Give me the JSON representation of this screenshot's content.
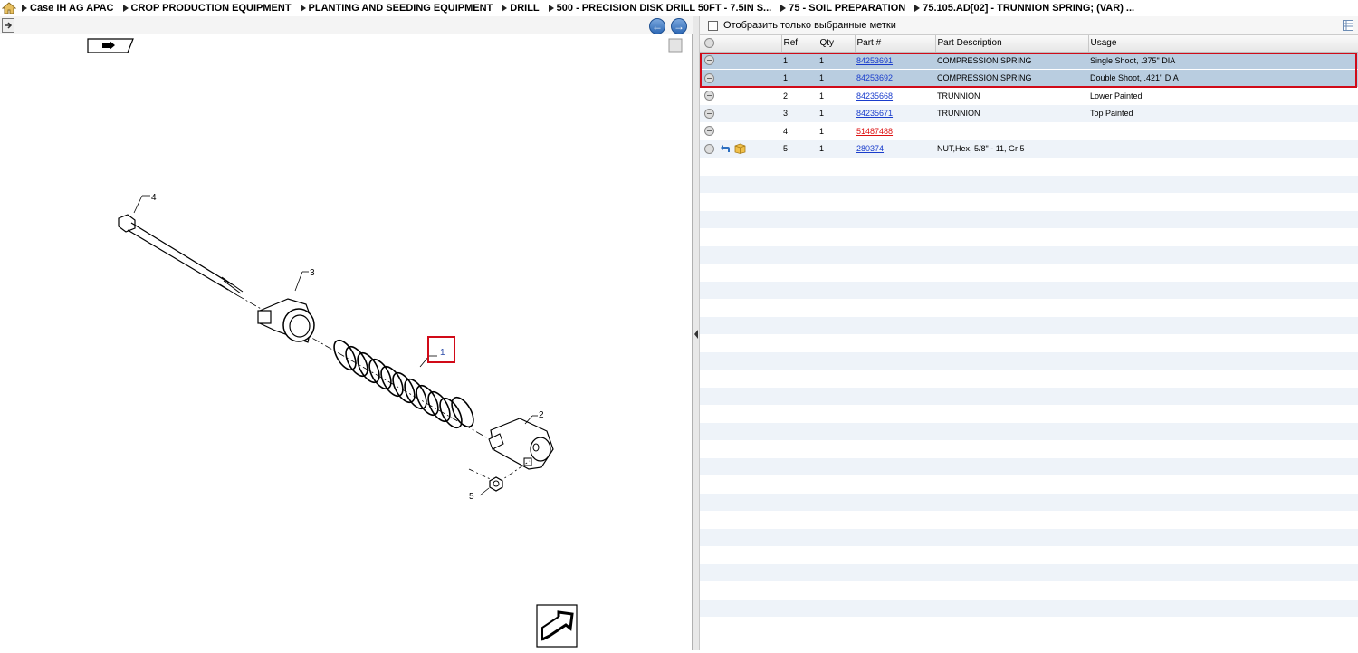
{
  "breadcrumb": [
    "Case IH AG APAC",
    "CROP PRODUCTION EQUIPMENT",
    "PLANTING AND SEEDING EQUIPMENT",
    "DRILL",
    "500 - PRECISION DISK DRILL 50FT - 7.5IN S...",
    "75 - SOIL PREPARATION",
    "75.105.AD[02] - TRUNNION SPRING; (VAR) ..."
  ],
  "filter": {
    "label": "Отобразить только выбранные метки"
  },
  "table": {
    "columns": [
      "",
      "Ref",
      "Qty",
      "Part #",
      "Part Description",
      "Usage"
    ],
    "rows": [
      {
        "ref": "1",
        "qty": "1",
        "part": "84253691",
        "desc": "COMPRESSION SPRING",
        "usage": "Single Shoot, .375\" DIA"
      },
      {
        "ref": "1",
        "qty": "1",
        "part": "84253692",
        "desc": "COMPRESSION SPRING",
        "usage": "Double Shoot, .421\" DIA"
      },
      {
        "ref": "2",
        "qty": "1",
        "part": "84235668",
        "desc": "TRUNNION",
        "usage": "Lower Painted"
      },
      {
        "ref": "3",
        "qty": "1",
        "part": "84235671",
        "desc": "TRUNNION",
        "usage": "Top Painted"
      },
      {
        "ref": "4",
        "qty": "1",
        "part": "51487488",
        "desc": "",
        "usage": ""
      },
      {
        "ref": "5",
        "qty": "1",
        "part": "280374",
        "desc": "NUT,Hex, 5/8\" - 11, Gr 5",
        "usage": ""
      }
    ]
  },
  "diagram": {
    "callouts": [
      "4",
      "3",
      "1",
      "2",
      "5"
    ]
  },
  "colors": {
    "highlight": "#d10a18",
    "selected_row": "#b9cde0",
    "link": "#1a3dcc",
    "link_alt": "#d11111"
  }
}
